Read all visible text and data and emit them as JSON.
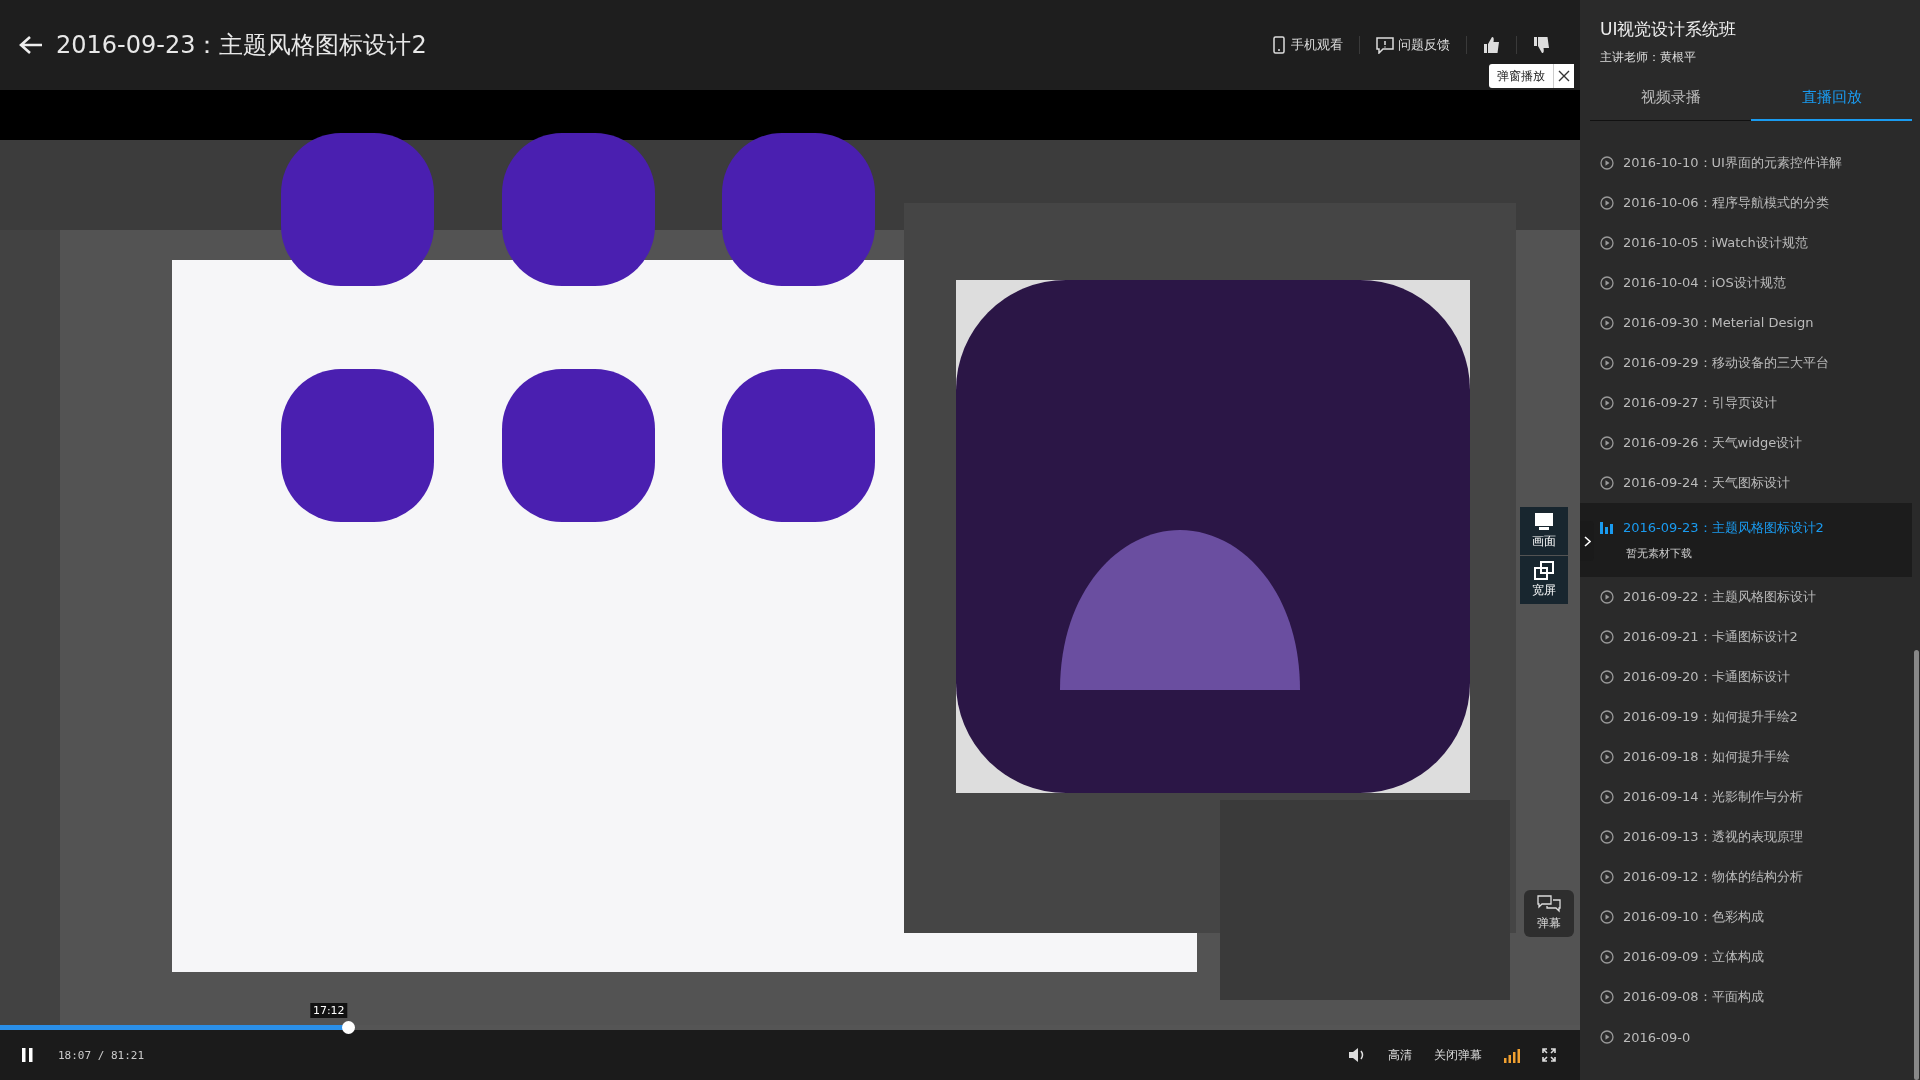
{
  "header": {
    "title": "2016-09-23：主题风格图标设计2",
    "actions": [
      {
        "kind": "phone",
        "label": "手机观看"
      },
      {
        "kind": "feedback",
        "label": "问题反馈"
      },
      {
        "kind": "like"
      },
      {
        "kind": "dislike"
      }
    ],
    "popup_toggle": {
      "label": "弹窗播放"
    }
  },
  "video": {
    "kind": "picture",
    "side_buttons": [
      {
        "kind": "screen",
        "label": "画面"
      },
      {
        "kind": "widescreen",
        "label": "宽屏"
      }
    ],
    "danmaku_button": {
      "label": "弹幕"
    }
  },
  "player": {
    "playing": true,
    "progress": {
      "level": 0.22,
      "hover_time": "17:12"
    },
    "time": "18:07 / 81:21",
    "quality": "高清",
    "danmaku_toggle": "关闭弹幕"
  },
  "sidebar": {
    "course_title": "UI视觉设计系统班",
    "teacher": "主讲老师：黄根平",
    "tabs": [
      {
        "label": "视频录播",
        "selected": false
      },
      {
        "label": "直播回放",
        "selected": true
      }
    ],
    "lessons": [
      {
        "title": "2016-10-10：UI界面的元素控件详解",
        "selected": false
      },
      {
        "title": "2016-10-06：程序导航模式的分类",
        "selected": false
      },
      {
        "title": "2016-10-05：iWatch设计规范",
        "selected": false
      },
      {
        "title": "2016-10-04：iOS设计规范",
        "selected": false
      },
      {
        "title": "2016-09-30：Meterial Design",
        "selected": false
      },
      {
        "title": "2016-09-29：移动设备的三大平台",
        "selected": false
      },
      {
        "title": "2016-09-27：引导页设计",
        "selected": false
      },
      {
        "title": "2016-09-26：天气widge设计",
        "selected": false
      },
      {
        "title": "2016-09-24：天气图标设计",
        "selected": false
      },
      {
        "title": "2016-09-23：主题风格图标设计2",
        "selected": true,
        "note": "暂无素材下载"
      },
      {
        "title": "2016-09-22：主题风格图标设计",
        "selected": false
      },
      {
        "title": "2016-09-21：卡通图标设计2",
        "selected": false
      },
      {
        "title": "2016-09-20：卡通图标设计",
        "selected": false
      },
      {
        "title": "2016-09-19：如何提升手绘2",
        "selected": false
      },
      {
        "title": "2016-09-18：如何提升手绘",
        "selected": false
      },
      {
        "title": "2016-09-14：光影制作与分析",
        "selected": false
      },
      {
        "title": "2016-09-13：透视的表现原理",
        "selected": false
      },
      {
        "title": "2016-09-12：物体的结构分析",
        "selected": false
      },
      {
        "title": "2016-09-10：色彩构成",
        "selected": false
      },
      {
        "title": "2016-09-09：立体构成",
        "selected": false
      },
      {
        "title": "2016-09-08：平面构成",
        "selected": false
      },
      {
        "title": "2016-09-0",
        "selected": false
      }
    ]
  }
}
